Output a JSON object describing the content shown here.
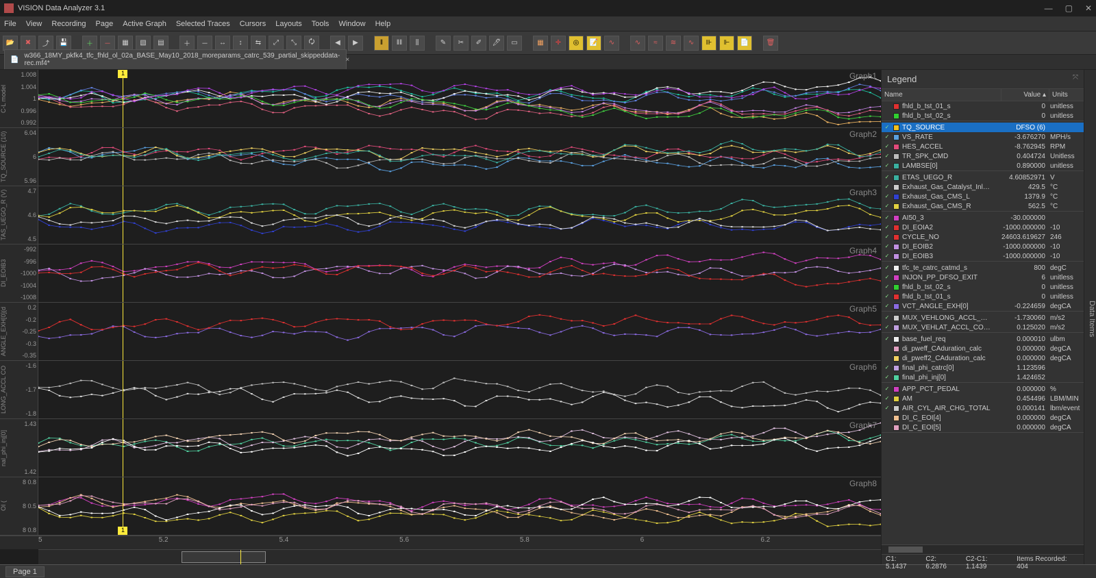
{
  "app_title": "VISION Data Analyzer 3.1",
  "menu": [
    "File",
    "View",
    "Recording",
    "Page",
    "Active Graph",
    "Selected Traces",
    "Cursors",
    "Layouts",
    "Tools",
    "Window",
    "Help"
  ],
  "tab_filename": "w366_18MY_pkfk4_tfc_fhld_ol_02a_BASE_May10_2018_moreparams_catrc_539_partial_skippeddata-rec.mf4*",
  "side_tab": "Data Items",
  "cursor_flag": "1",
  "xaxis_ticks": [
    "5",
    "5.2",
    "5.4",
    "5.6",
    "5.8",
    "6",
    "6.2"
  ],
  "graphs": [
    {
      "label": "Graph1",
      "ylabel": "C-L model",
      "yticks": [
        "1.008",
        "1.004",
        "1",
        "0.996",
        "0.992"
      ]
    },
    {
      "label": "Graph2",
      "ylabel": "TQ_SOURCE (10)",
      "yticks": [
        "6.04",
        "6",
        "5.96"
      ]
    },
    {
      "label": "Graph3",
      "ylabel": "TAS_UEGO_R (V)",
      "yticks": [
        "4.7",
        "4.6",
        "4.5"
      ]
    },
    {
      "label": "Graph4",
      "ylabel": "DI_EOIB3",
      "yticks": [
        "-992",
        "-996",
        "-1000",
        "-1004",
        "-1008"
      ]
    },
    {
      "label": "Graph5",
      "ylabel": "ANGLE_EXH[0](d",
      "yticks": [
        "0.2",
        "-0.2",
        "-0.25",
        "-0.3",
        "-0.35"
      ]
    },
    {
      "label": "Graph6",
      "ylabel": "LONG_ACCL CO",
      "yticks": [
        "-1.6",
        "-1.7",
        "-1.8"
      ]
    },
    {
      "label": "Graph7",
      "ylabel": "nal_phi_inj[0]",
      "yticks": [
        "1.43",
        "1.42"
      ]
    },
    {
      "label": "Graph8",
      "ylabel": "OI (",
      "yticks": [
        "8 0.8",
        "8 0.5",
        "8 0.8"
      ]
    }
  ],
  "legend_title": "Legend",
  "legend_head": {
    "c1": "Name",
    "c2": "Value",
    "c3": "Units"
  },
  "legend_groups": [
    {
      "rows": [
        {
          "color": "#e03030",
          "name": "fhld_b_tst_01_s",
          "value": "0",
          "units": "unitless",
          "chk": false
        },
        {
          "color": "#30d030",
          "name": "fhld_b_tst_02_s",
          "value": "0",
          "units": "unitless",
          "chk": false
        }
      ]
    },
    {
      "rows": [
        {
          "color": "#f0c020",
          "name": "TQ_SOURCE",
          "value": "DFSO  (6)",
          "units": "",
          "chk": true,
          "selected": true
        },
        {
          "color": "#5aa0e0",
          "name": "VS_RATE",
          "value": "-3.676270",
          "units": "MPH/s",
          "chk": true
        },
        {
          "color": "#e04a7a",
          "name": "HES_ACCEL",
          "value": "-8.762945",
          "units": "RPM",
          "chk": true
        },
        {
          "color": "#bbbbbb",
          "name": "TR_SPK_CMD",
          "value": "0.404724",
          "units": "Unitless",
          "chk": true
        },
        {
          "color": "#3ab0a0",
          "name": "LAMBSE[0]",
          "value": "0.890000",
          "units": "unitless",
          "chk": true
        }
      ]
    },
    {
      "rows": [
        {
          "color": "#3ab0a0",
          "name": "ETAS_UEGO_R",
          "value": "4.60852971",
          "units": "V",
          "chk": true
        },
        {
          "color": "#cccccc",
          "name": "Exhaust_Gas_Catalyst_Inlet_R",
          "value": "429.5",
          "units": "°C",
          "chk": true
        },
        {
          "color": "#3040d0",
          "name": "Exhaust_Gas_CMS_L",
          "value": "1379.9",
          "units": "°C",
          "chk": true
        },
        {
          "color": "#e0d040",
          "name": "Exhaust_Gas_CMS_R",
          "value": "562.5",
          "units": "°C",
          "chk": true
        }
      ]
    },
    {
      "rows": [
        {
          "color": "#d040c0",
          "name": "AI50_3",
          "value": "-30.000000",
          "units": "",
          "chk": true
        },
        {
          "color": "#e03030",
          "name": "DI_EOIA2",
          "value": "-1000.000000",
          "units": "-10",
          "chk": true
        },
        {
          "color": "#e03030",
          "name": "CYCLE_NO",
          "value": "24603.619627",
          "units": "246",
          "chk": true
        },
        {
          "color": "#c090e0",
          "name": "DI_EOIB2",
          "value": "-1000.000000",
          "units": "-10",
          "chk": true
        },
        {
          "color": "#c090e0",
          "name": "DI_EOIB3",
          "value": "-1000.000000",
          "units": "-10",
          "chk": true
        }
      ]
    },
    {
      "rows": [
        {
          "color": "#eeeeee",
          "name": "tfc_te_catrc_catmd_s",
          "value": "800",
          "units": "degC",
          "chk": true
        },
        {
          "color": "#d040c0",
          "name": "INJON_PP_DFSO_EXIT",
          "value": "6",
          "units": "unitless",
          "chk": true
        },
        {
          "color": "#30d030",
          "name": "fhld_b_tst_02_s",
          "value": "0",
          "units": "unitless",
          "chk": true
        },
        {
          "color": "#e03030",
          "name": "fhld_b_tst_01_s",
          "value": "0",
          "units": "unitless",
          "chk": true
        },
        {
          "color": "#8a6ae0",
          "name": "VCT_ANGLE_EXH[0]",
          "value": "-0.224659",
          "units": "degCA",
          "chk": true
        }
      ]
    },
    {
      "rows": [
        {
          "color": "#cccccc",
          "name": "MUX_VEHLONG_ACCL_COMP",
          "value": "-1.730060",
          "units": "m/s2",
          "chk": true
        },
        {
          "color": "#c0a0e0",
          "name": "MUX_VEHLAT_ACCL_COMP",
          "value": "0.125020",
          "units": "m/s2",
          "chk": true
        }
      ]
    },
    {
      "rows": [
        {
          "color": "#eeeeee",
          "name": "base_fuel_req",
          "value": "0.000010",
          "units": "ulbm",
          "chk": true
        },
        {
          "color": "#e0a0c0",
          "name": "di_pweff_CAduration_calc",
          "value": "0.000000",
          "units": "degCA",
          "chk": false
        },
        {
          "color": "#f0d060",
          "name": "di_pweff2_CAduration_calc",
          "value": "0.000000",
          "units": "degCA",
          "chk": false
        },
        {
          "color": "#c0a0e0",
          "name": "final_phi_catrc[0]",
          "value": "1.123596",
          "units": "",
          "chk": true
        },
        {
          "color": "#50d0a0",
          "name": "final_phi_inj[0]",
          "value": "1.424652",
          "units": "",
          "chk": true
        }
      ]
    },
    {
      "rows": [
        {
          "color": "#d040c0",
          "name": "APP_PCT_PEDAL",
          "value": "0.000000",
          "units": "%",
          "chk": true
        },
        {
          "color": "#e0d040",
          "name": "AM",
          "value": "0.454496",
          "units": "LBM/MIN",
          "chk": true
        },
        {
          "color": "#cccccc",
          "name": "AIR_CYL_AIR_CHG_TOTAL",
          "value": "0.000141",
          "units": "lbm/event",
          "chk": true
        },
        {
          "color": "#f0c090",
          "name": "DI_C_EOI[4]",
          "value": "0.000000",
          "units": "degCA",
          "chk": false
        },
        {
          "color": "#e0a0c0",
          "name": "DI_C_EOI[5]",
          "value": "0.000000",
          "units": "degCA",
          "chk": false
        }
      ]
    }
  ],
  "status_right": {
    "c1": "C1: 5.1437",
    "c2": "C2: 6.2876",
    "diff": "C2-C1: 1.1439",
    "rec": "Items Recorded: 404"
  },
  "status_page": "Page 1"
}
